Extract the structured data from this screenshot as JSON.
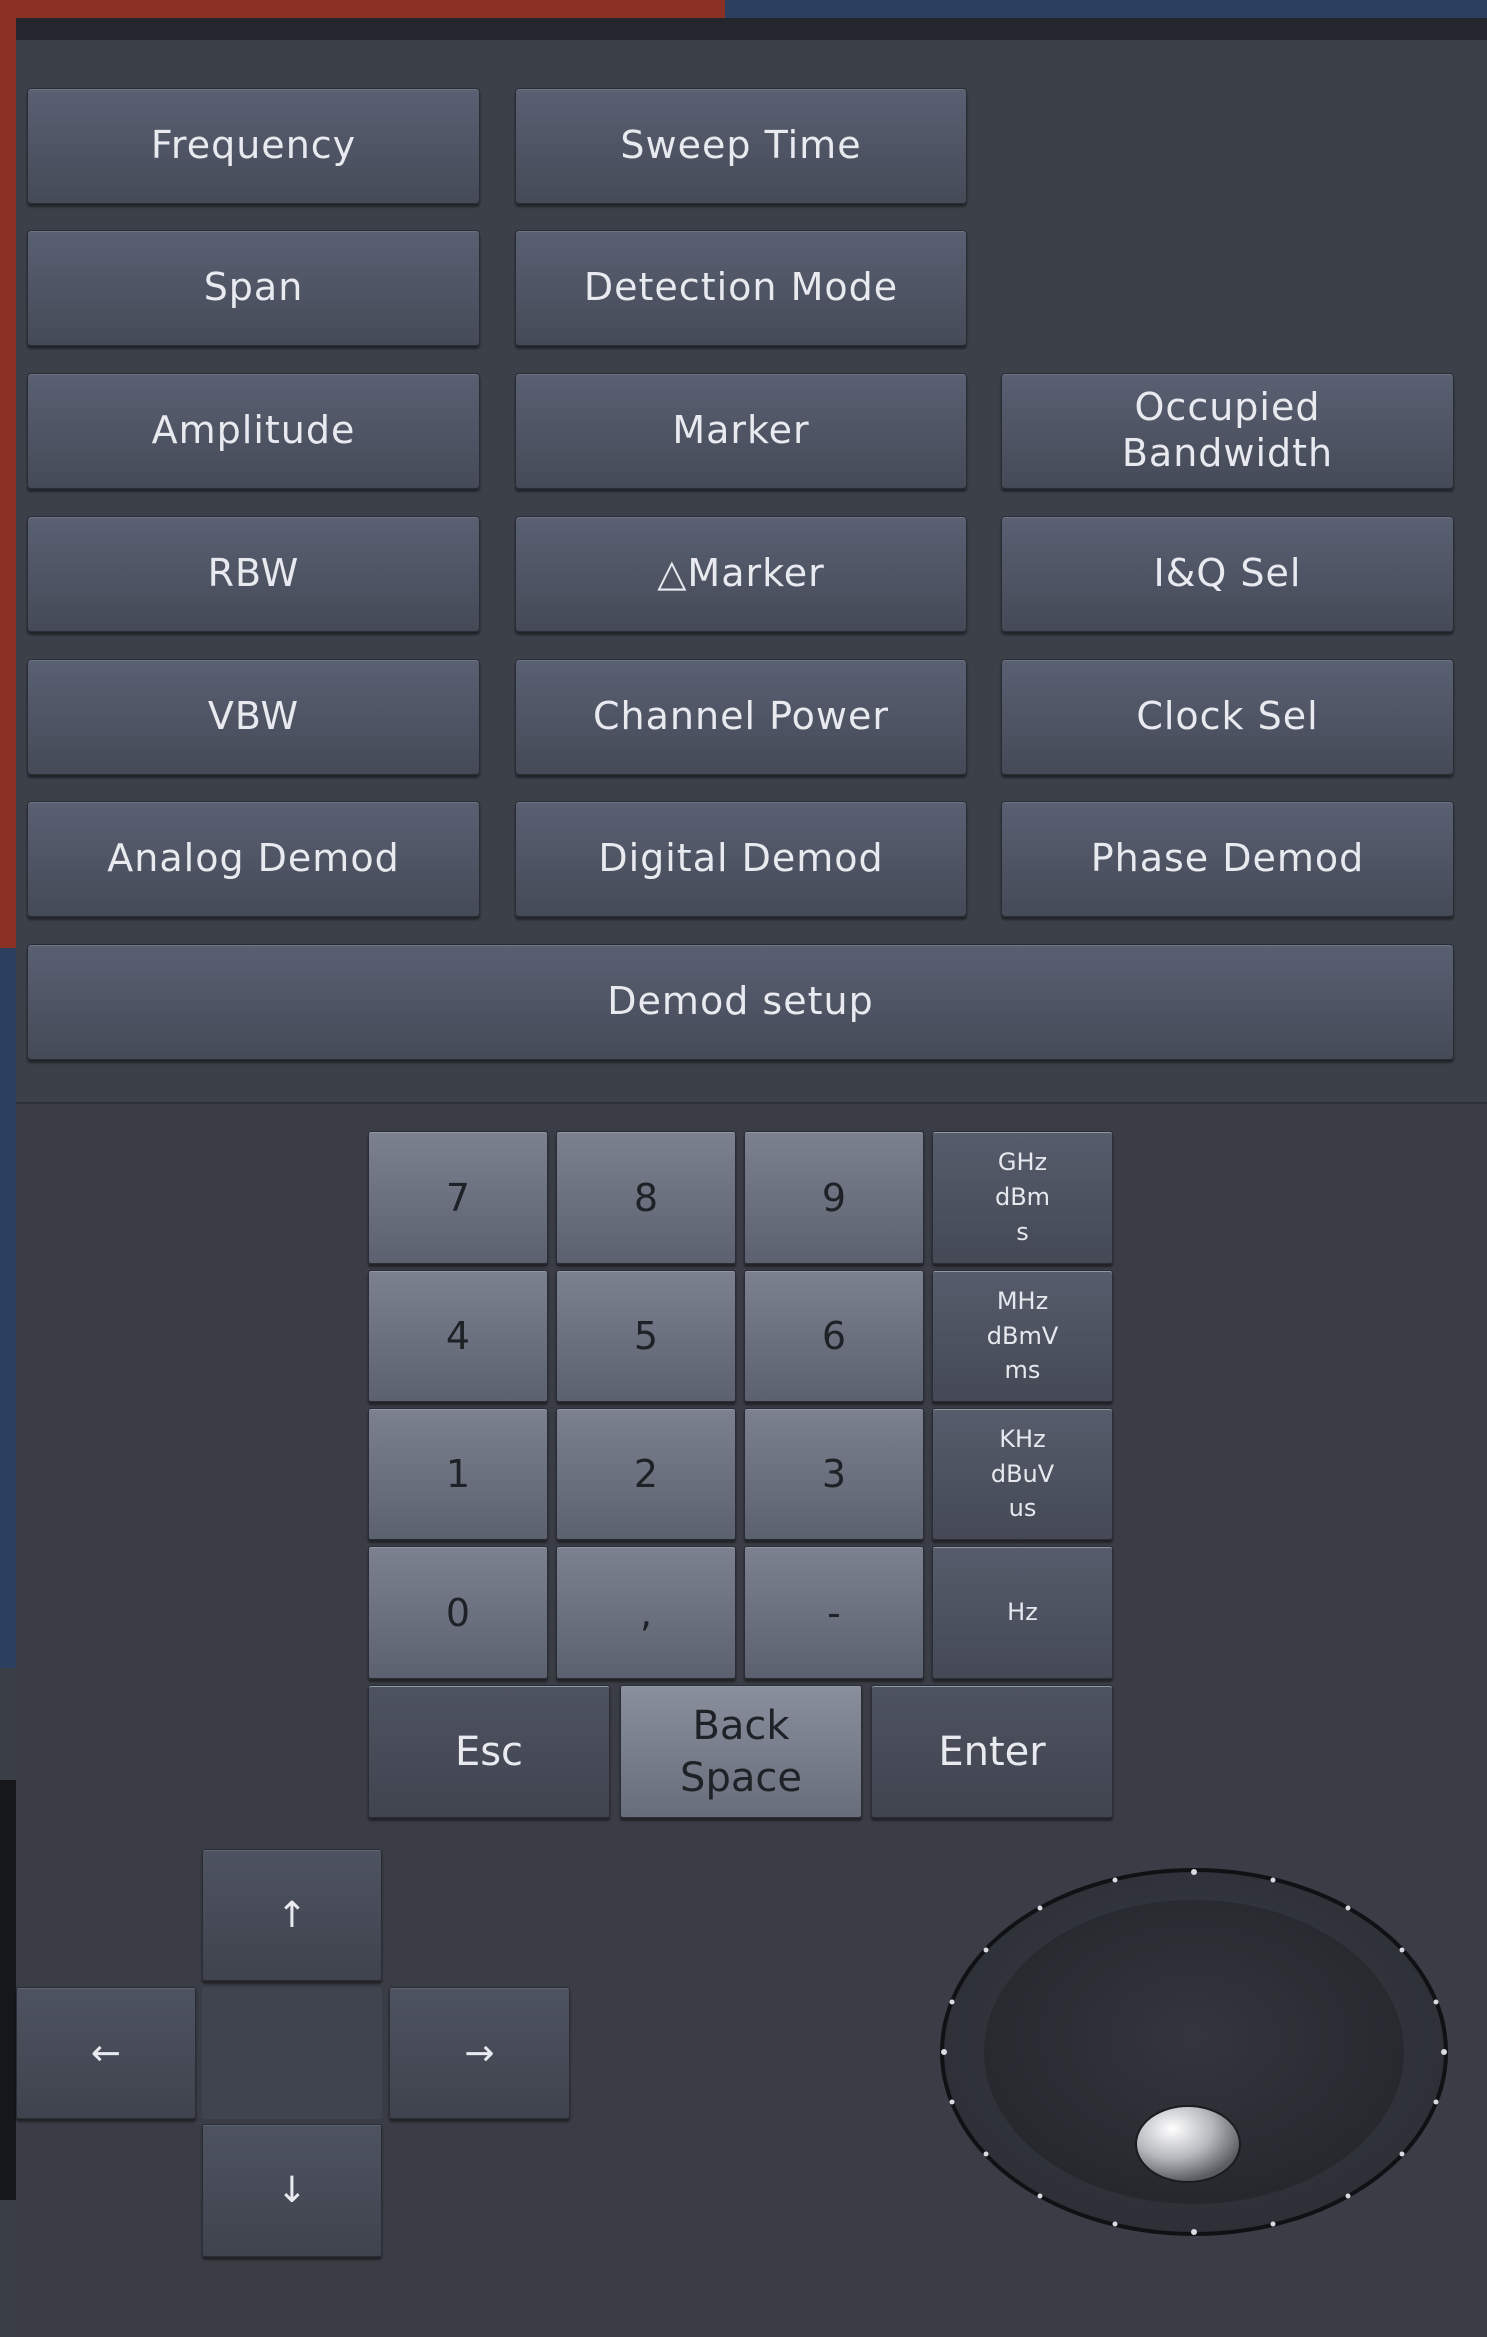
{
  "function_buttons": {
    "frequency": "Frequency",
    "sweep_time": "Sweep Time",
    "span": "Span",
    "detection_mode": "Detection Mode",
    "amplitude": "Amplitude",
    "marker": "Marker",
    "occupied_bandwidth": "Occupied\nBandwidth",
    "rbw": "RBW",
    "delta_marker": "△Marker",
    "iq_sel": "I&Q Sel",
    "vbw": "VBW",
    "channel_power": "Channel Power",
    "clock_sel": "Clock Sel",
    "analog_demod": "Analog Demod",
    "digital_demod": "Digital Demod",
    "phase_demod": "Phase Demod",
    "demod_setup": "Demod setup"
  },
  "keypad": {
    "k7": "7",
    "k8": "8",
    "k9": "9",
    "unit_ghz": "GHz\ndBm\ns",
    "k4": "4",
    "k5": "5",
    "k6": "6",
    "unit_mhz": "MHz\ndBmV\nms",
    "k1": "1",
    "k2": "2",
    "k3": "3",
    "unit_khz": "KHz\ndBuV\nus",
    "k0": "0",
    "comma": ",",
    "minus": "-",
    "unit_hz": "Hz",
    "esc": "Esc",
    "backspace": "Back\nSpace",
    "enter": "Enter"
  },
  "arrows": {
    "up": "↑",
    "left": "←",
    "right": "→",
    "down": "↓"
  },
  "colors": {
    "panel": "#3c4049",
    "button_top": "#596072",
    "button_bottom": "#454a57",
    "accent_red": "#8a3024",
    "accent_blue": "#2d3f5e"
  }
}
